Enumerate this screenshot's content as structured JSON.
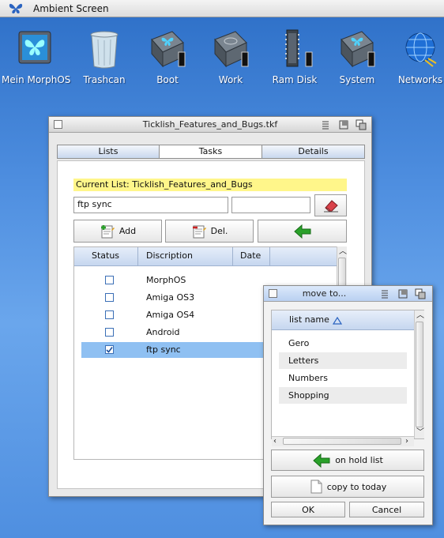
{
  "screen_title": "Ambient Screen",
  "desktop_icons": [
    {
      "label": "Mein MorphOS"
    },
    {
      "label": "Trashcan"
    },
    {
      "label": "Boot"
    },
    {
      "label": "Work"
    },
    {
      "label": "Ram Disk"
    },
    {
      "label": "System"
    },
    {
      "label": "Networks"
    }
  ],
  "main_window": {
    "title": "Ticklish_Features_and_Bugs.tkf",
    "tabs": [
      "Lists",
      "Tasks",
      "Details"
    ],
    "current_list_label": "Current List: Ticklish_Features_and_Bugs",
    "task_input_value": "ftp sync",
    "second_input_value": "",
    "buttons": {
      "add": "Add",
      "del": "Del."
    },
    "columns": [
      "Status",
      "Discription",
      "Date"
    ],
    "rows": [
      {
        "name": "MorphOS",
        "checked": false
      },
      {
        "name": "Amiga OS3",
        "checked": false
      },
      {
        "name": "Amiga OS4",
        "checked": false
      },
      {
        "name": "Android",
        "checked": false
      },
      {
        "name": "ftp sync",
        "checked": true
      }
    ]
  },
  "move_window": {
    "title": "move to...",
    "list_header": "list name",
    "lists": [
      "Gero",
      "Letters",
      "Numbers",
      "Shopping"
    ],
    "on_hold_label": "on hold list",
    "copy_today_label": "copy to today",
    "ok_label": "OK",
    "cancel_label": "Cancel"
  },
  "colors": {
    "current_list_bg": "#fff68a",
    "selected_row": "#8fc0f2",
    "accent_green": "#2aa12a"
  }
}
